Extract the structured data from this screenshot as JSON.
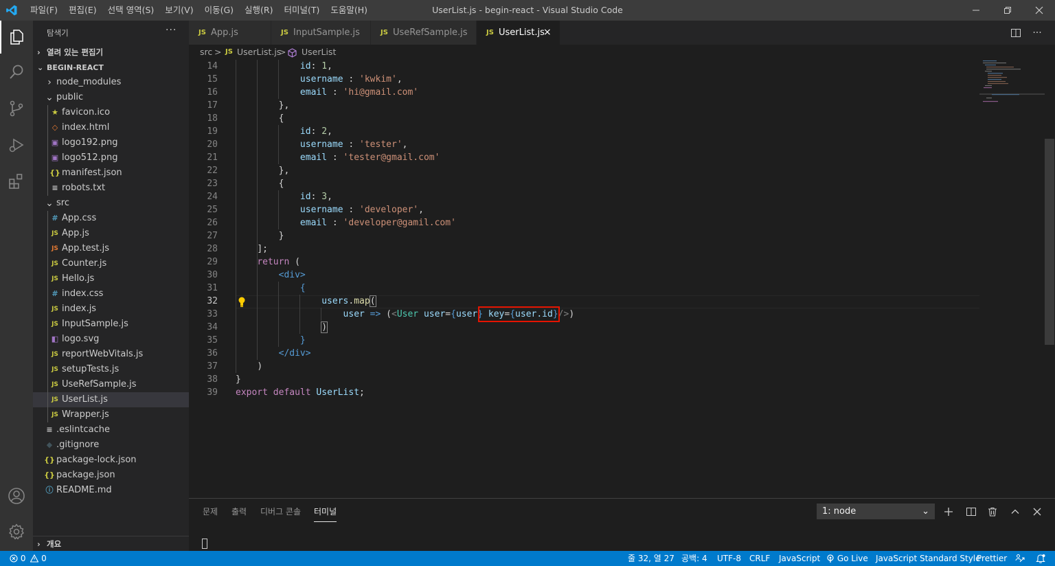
{
  "window": {
    "title": "UserList.js - begin-react - Visual Studio Code",
    "menu": [
      "파일(F)",
      "편집(E)",
      "선택 영역(S)",
      "보기(V)",
      "이동(G)",
      "실행(R)",
      "터미널(T)",
      "도움말(H)"
    ]
  },
  "colors": {
    "accent": "#007acc",
    "titlebar": "#3c3c3c",
    "activitybar": "#333333",
    "sidebar": "#252526",
    "editor": "#1e1e1e",
    "highlight_box": "#e51400",
    "js_icon": "#cbcb41"
  },
  "activity_bar": {
    "icons": [
      "explorer-icon",
      "search-icon",
      "source-control-icon",
      "run-debug-icon",
      "extensions-icon",
      "account-icon",
      "settings-gear-icon"
    ]
  },
  "sidebar": {
    "title": "탐색기",
    "more": "···",
    "open_editors": "열려 있는 편집기",
    "project": "BEGIN-REACT",
    "outline": "개요",
    "tree": [
      {
        "name": "node_modules",
        "icon": "chevron-right"
      },
      {
        "name": "public",
        "icon": "chevron-down"
      },
      {
        "name": "favicon.ico",
        "icon": "star"
      },
      {
        "name": "index.html",
        "icon": "html"
      },
      {
        "name": "logo192.png",
        "icon": "image"
      },
      {
        "name": "logo512.png",
        "icon": "image"
      },
      {
        "name": "manifest.json",
        "icon": "json"
      },
      {
        "name": "robots.txt",
        "icon": "text"
      },
      {
        "name": "src",
        "icon": "chevron-down"
      },
      {
        "name": "App.css",
        "icon": "css"
      },
      {
        "name": "App.js",
        "icon": "js"
      },
      {
        "name": "App.test.js",
        "icon": "js-test"
      },
      {
        "name": "Counter.js",
        "icon": "js"
      },
      {
        "name": "Hello.js",
        "icon": "js"
      },
      {
        "name": "index.css",
        "icon": "css"
      },
      {
        "name": "index.js",
        "icon": "js"
      },
      {
        "name": "InputSample.js",
        "icon": "js"
      },
      {
        "name": "logo.svg",
        "icon": "svg"
      },
      {
        "name": "reportWebVitals.js",
        "icon": "js"
      },
      {
        "name": "setupTests.js",
        "icon": "js"
      },
      {
        "name": "UseRefSample.js",
        "icon": "js"
      },
      {
        "name": "UserList.js",
        "icon": "js"
      },
      {
        "name": "Wrapper.js",
        "icon": "js"
      },
      {
        "name": ".eslintcache",
        "icon": "text"
      },
      {
        "name": ".gitignore",
        "icon": "git"
      },
      {
        "name": "package-lock.json",
        "icon": "json"
      },
      {
        "name": "package.json",
        "icon": "json"
      },
      {
        "name": "README.md",
        "icon": "info"
      }
    ]
  },
  "tabs": [
    {
      "label": "App.js",
      "badge": "JS"
    },
    {
      "label": "InputSample.js",
      "badge": "JS"
    },
    {
      "label": "UseRefSample.js",
      "badge": "JS"
    },
    {
      "label": "UserList.js",
      "badge": "JS",
      "active": true,
      "close": "×"
    }
  ],
  "breadcrumb": {
    "folder": "src",
    "file": "UserList.js",
    "file_badge": "JS",
    "symbol": "UserList",
    "sep": ">"
  },
  "editor": {
    "line_numbers": [
      "14",
      "15",
      "16",
      "17",
      "18",
      "19",
      "20",
      "21",
      "22",
      "23",
      "24",
      "25",
      "26",
      "27",
      "28",
      "29",
      "30",
      "31",
      "32",
      "33",
      "34",
      "35",
      "36",
      "37",
      "38",
      "39"
    ],
    "current_line": "32",
    "code": {
      "l14_key": "id",
      "l14_val": "1",
      "l15_key": "username",
      "l15_val": "'kwkim'",
      "l16_key": "email",
      "l16_val": "'hi@gmail.com'",
      "l17": "},",
      "l18": "{",
      "l19_key": "id",
      "l19_val": "2",
      "l20_key": "username",
      "l20_val": "'tester'",
      "l21_key": "email",
      "l21_val": "'tester@gmail.com'",
      "l22": "},",
      "l23": "{",
      "l24_key": "id",
      "l24_val": "3",
      "l25_key": "username",
      "l25_val": "'developer'",
      "l26_key": "email",
      "l26_val": "'developer@gamil.com'",
      "l27": "}",
      "l28": "];",
      "l29_kw": "return",
      "l29_p": " (",
      "l30_tag": "<div>",
      "l31": "{",
      "l32_obj": "users",
      "l32_fn": "map",
      "l32_p": "(",
      "l33_param": "user",
      "l33_arrow": " => ",
      "l33_open": "(",
      "l33_lt": "<",
      "l33_comp": "User",
      "l33_attr1": "user",
      "l33_eq1": "=",
      "l33_b1o": "{",
      "l33_v1": "user",
      "l33_b1c": "}",
      "l33_attr2": "key",
      "l33_eq2": "=",
      "l33_b2o": "{",
      "l33_v2": "user.id",
      "l33_b2c": "}",
      "l33_close": "/>",
      "l33_end": ")",
      "l34": ")",
      "l35": "}",
      "l36_tag": "</div>",
      "l37": ")",
      "l38": "}",
      "l39_kw1": "export",
      "l39_kw2": "default",
      "l39_name": "UserList",
      "l39_semi": ";"
    }
  },
  "panel": {
    "tabs": [
      "문제",
      "출력",
      "디버그 콘솔",
      "터미널"
    ],
    "active_tab": "터미널",
    "terminal_select": "1: node"
  },
  "status": {
    "errors": "0",
    "warnings": "0",
    "position": "줄 32, 열 27",
    "spaces": "공백: 4",
    "encoding": "UTF-8",
    "eol": "CRLF",
    "language": "JavaScript",
    "golive": "Go Live",
    "style": "JavaScript Standard Style",
    "prettier": "Prettier"
  }
}
